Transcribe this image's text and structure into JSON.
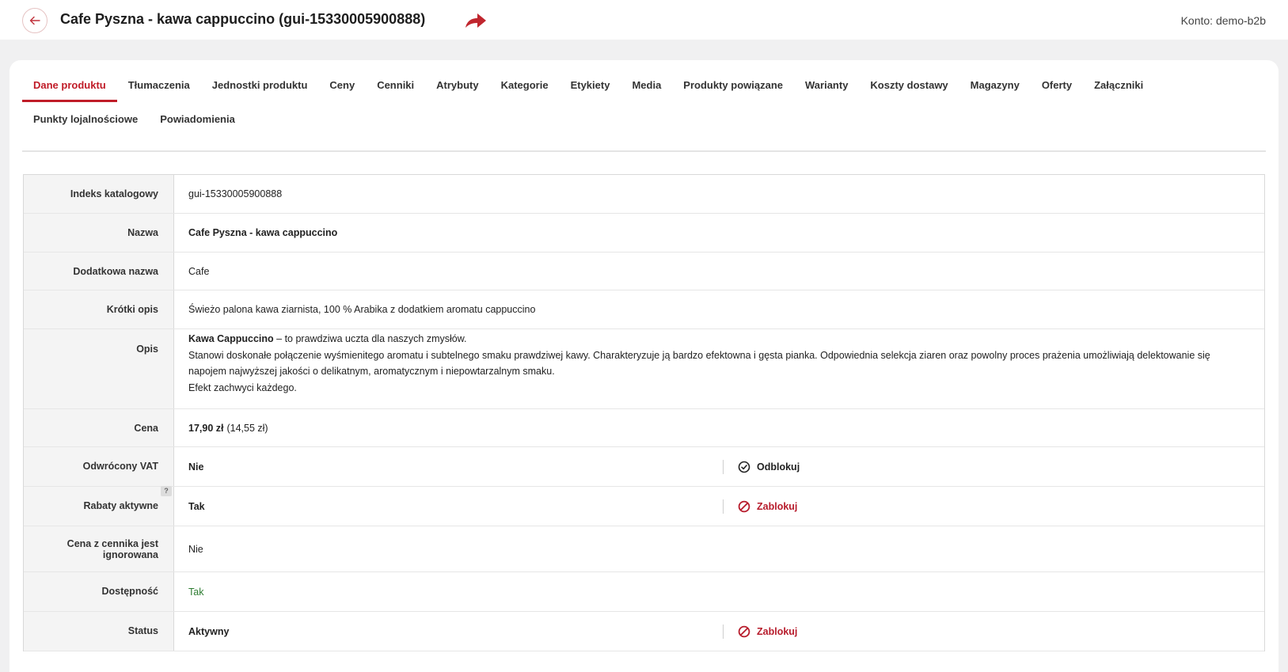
{
  "header": {
    "title": "Cafe Pyszna - kawa cappuccino (gui-15330005900888)",
    "account": "Konto: demo-b2b"
  },
  "tabs": {
    "row1": [
      "Dane produktu",
      "Tłumaczenia",
      "Jednostki produktu",
      "Ceny",
      "Cenniki",
      "Atrybuty",
      "Kategorie",
      "Etykiety",
      "Media",
      "Produkty powiązane",
      "Warianty",
      "Koszty dostawy",
      "Magazyny",
      "Oferty",
      "Załączniki"
    ],
    "row2": [
      "Punkty lojalnościowe",
      "Powiadomienia"
    ],
    "active": "Dane produktu"
  },
  "fields": {
    "index": {
      "label": "Indeks katalogowy",
      "value": "gui-15330005900888"
    },
    "name": {
      "label": "Nazwa",
      "value": "Cafe Pyszna - kawa cappuccino"
    },
    "extra_name": {
      "label": "Dodatkowa nazwa",
      "value": "Cafe"
    },
    "short_desc": {
      "label": "Krótki opis",
      "value": "Świeżo palona kawa ziarnista, 100 % Arabika z dodatkiem aromatu cappuccino"
    },
    "desc": {
      "label": "Opis",
      "lead_bold": "Kawa Cappuccino",
      "lead_rest": " – to prawdziwa uczta dla naszych zmysłów.",
      "line2": "Stanowi doskonałe połączenie wyśmienitego aromatu i subtelnego smaku prawdziwej kawy. Charakteryzuje ją bardzo efektowna i gęsta pianka. Odpowiednia selekcja ziaren oraz powolny proces prażenia umożliwiają delektowanie się napojem najwyższej jakości o delikatnym, aromatycznym i niepowtarzalnym smaku.",
      "line3": "Efekt zachwyci każdego."
    },
    "price": {
      "label": "Cena",
      "gross": "17,90 zł",
      "net": "(14,55 zł)"
    },
    "reverse_vat": {
      "label": "Odwrócony VAT",
      "value": "Nie",
      "action": "Odblokuj"
    },
    "discounts": {
      "label": "Rabaty aktywne",
      "value": "Tak",
      "action": "Zablokuj",
      "help": "?"
    },
    "pricelist_ignored": {
      "label": "Cena z cennika jest ignorowana",
      "value": "Nie"
    },
    "availability": {
      "label": "Dostępność",
      "value": "Tak"
    },
    "status": {
      "label": "Status",
      "value": "Aktywny",
      "action": "Zablokuj"
    }
  },
  "colors": {
    "accent": "#c01c28",
    "green": "#2e7d32",
    "background": "#f0f0f1"
  }
}
